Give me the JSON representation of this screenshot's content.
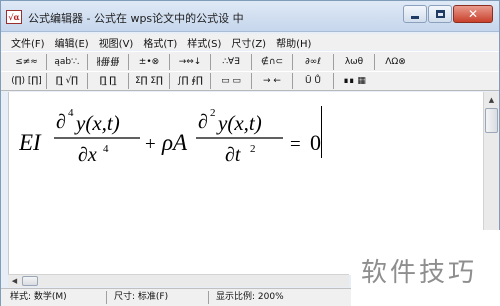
{
  "window": {
    "title": "公式编辑器 - 公式在 wps论文中的公式设 中",
    "icon": "equation-editor-app-icon"
  },
  "menu": [
    "文件(F)",
    "编辑(E)",
    "视图(V)",
    "格式(T)",
    "样式(S)",
    "尺寸(Z)",
    "帮助(H)"
  ],
  "toolbar_row1": [
    "≤≠≈",
    "ąab∵.",
    "∦∰∰",
    "±•⊗",
    "→⇔↓",
    "∴∀∃",
    "∉∩⊂",
    "∂∞ℓ",
    "λωθ",
    "ΛΩ⊗"
  ],
  "toolbar_row2": [
    "(∏) [∏]",
    "∏̲ √∏",
    "∏̲ ∏̲",
    "Σ∏ Σ∏",
    "∫∏ ∮∏",
    "▭ ▭",
    "→ ←",
    "Ū Ů",
    "∎∎ ▦"
  ],
  "equation": {
    "lhs_coeff": "EI",
    "partial": "∂",
    "num1_power": "4",
    "num1_func": "y(x,t)",
    "den1_var": "∂x",
    "den1_power": "4",
    "plus": "+",
    "rho_a": "ρA",
    "num2_power": "2",
    "num2_func": "y(x,t)",
    "den2_var": "∂t",
    "den2_power": "2",
    "equals": "=",
    "rhs": "0"
  },
  "status": {
    "style_label": "样式: 数学(M)",
    "size_label": "尺寸: 标准(F)",
    "zoom_label": "显示比例: 200%"
  },
  "watermark": "软件技巧"
}
